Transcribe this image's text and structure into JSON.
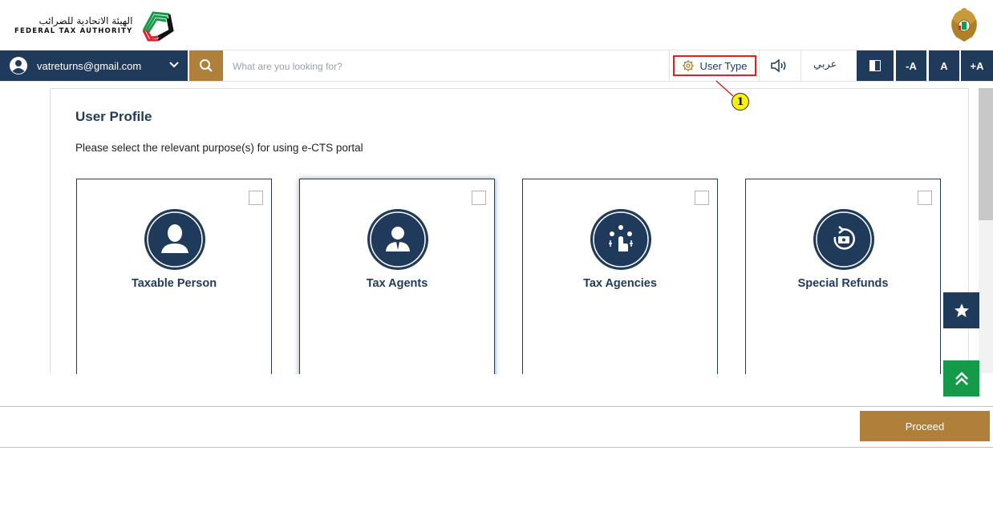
{
  "header": {
    "logo_arabic": "الهيئة الاتحادية للضرائب",
    "logo_english": "FEDERAL TAX AUTHORITY",
    "logo_icon": "fta-logo-icon",
    "emblem_icon": "uae-emblem-icon"
  },
  "toolbar": {
    "user_email": "vatreturns@gmail.com",
    "search_placeholder": "What are you looking for?",
    "user_type_label": "User Type",
    "language_label": "عربي",
    "font_decrease_label": "-A",
    "font_reset_label": "A",
    "font_increase_label": "+A"
  },
  "callout": {
    "number": "1"
  },
  "main": {
    "title": "User Profile",
    "subtitle": "Please select the relevant purpose(s) for using e-CTS portal",
    "cards": [
      {
        "label": "Taxable Person",
        "icon": "person-icon",
        "checked": false
      },
      {
        "label": "Tax Agents",
        "icon": "agent-icon",
        "checked": false
      },
      {
        "label": "Tax Agencies",
        "icon": "agencies-icon",
        "checked": false
      },
      {
        "label": "Special Refunds",
        "icon": "refund-icon",
        "checked": false
      }
    ]
  },
  "footer": {
    "proceed_label": "Proceed"
  },
  "colors": {
    "navy": "#1f3a5a",
    "gold": "#b0803a",
    "green": "#149a48",
    "callout_red": "#e02020",
    "callout_yellow": "#fff200"
  }
}
